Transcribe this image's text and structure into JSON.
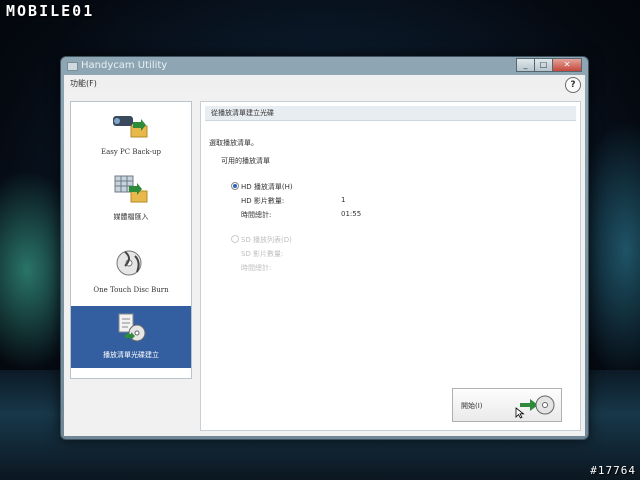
{
  "photo": {
    "watermark": "MOBILE01",
    "tag_number": "#17764"
  },
  "window": {
    "title": "Handycam Utility",
    "controls": {
      "minimize": "_",
      "maximize": "□",
      "close": "✕"
    },
    "menu": {
      "functions": "功能(F)"
    },
    "help_label": "?"
  },
  "sidebar": {
    "items": [
      {
        "label": "Easy PC Back-up",
        "icon": "camera-to-folder-icon",
        "selected": false
      },
      {
        "label": "媒體檔匯入",
        "icon": "media-grid-to-folder-icon",
        "selected": false
      },
      {
        "label": "One Touch Disc Burn",
        "icon": "disc-burn-icon",
        "selected": false
      },
      {
        "label": "播放清單光碟建立",
        "icon": "playlist-disc-icon",
        "selected": true
      }
    ]
  },
  "main": {
    "section_title": "從播放清單建立光碟",
    "prompt": "選取播放清單。",
    "available_label": "可用的播放清單",
    "hd": {
      "option": "HD 播放清單(H)",
      "count_label": "HD 影片數量:",
      "count_value": "1",
      "time_label": "時間總計:",
      "time_value": "01:55"
    },
    "sd": {
      "option": "SD 播放列表(D)",
      "count_label": "SD 影片數量:",
      "time_label": "時間總計:"
    },
    "start_button": "開始(I)"
  },
  "colors": {
    "selected_nav": "#335fa0",
    "titlebar": "#8fa7b4",
    "close_button": "#c4473a"
  }
}
